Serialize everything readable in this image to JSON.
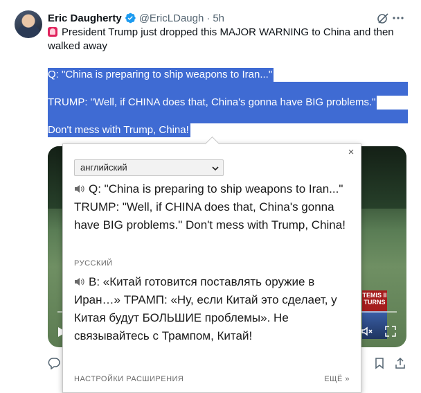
{
  "tweet": {
    "author_name": "Eric Daugherty",
    "handle": "@EricLDaugh",
    "separator": "·",
    "time": "5h",
    "text": "President Trump just dropped this MAJOR WARNING to China and then walked away",
    "highlighted_lines": [
      "Q: \"China is preparing to ship weapons to Iran...\"",
      "TRUMP: \"Well, if CHINA does that, China's gonna have BIG problems.\"",
      "Don't mess with Trump, China!"
    ],
    "video_badge": "TEMIS II\nTURNS"
  },
  "translate_popup": {
    "close_label": "×",
    "source_language": "английский",
    "source_text": "Q: \"China is preparing to ship weapons to Iran...\" TRUMP: \"Well, if CHINA does that, China's gonna have BIG problems.\" Don't mess with Trump, China!",
    "target_language": "РУССКИЙ",
    "target_text": "В: «Китай готовится поставлять оружие в Иран…» ТРАМП: «Ну, если Китай это сделает, у Китая будут БОЛЬШИЕ проблемы». Не связывайтесь с Трампом, Китай!",
    "footer_settings": "НАСТРОЙКИ РАСШИРЕНИЯ",
    "footer_more": "ЕЩЁ »"
  },
  "colors": {
    "selection": "#3f6bd3",
    "verified": "#1d9bf0",
    "secondary_text": "#536471"
  },
  "icons": [
    "verified-badge-icon",
    "grok-icon",
    "more-icon",
    "alarm-icon",
    "speaker-icon",
    "play-icon",
    "volume-icon",
    "fullscreen-icon",
    "reply-icon",
    "bookmark-icon",
    "share-icon",
    "chevron-down-icon",
    "close-icon"
  ]
}
